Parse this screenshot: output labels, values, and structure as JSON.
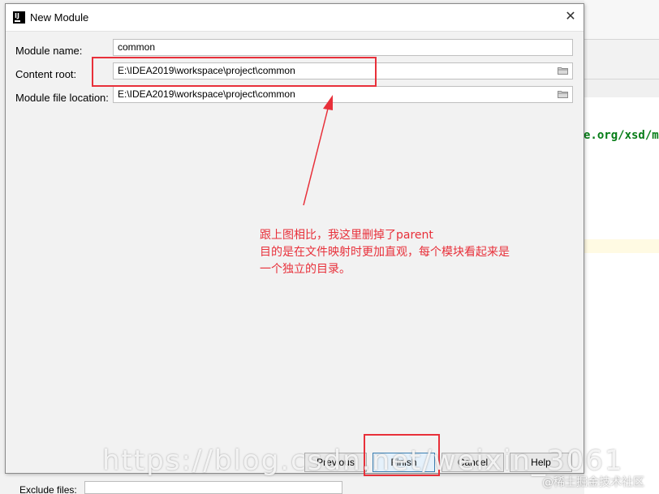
{
  "dialog": {
    "title": "New Module",
    "close_glyph": "✕"
  },
  "form": {
    "module_name": {
      "label": "Module name:",
      "value": "common"
    },
    "content_root": {
      "label": "Content root:",
      "value": "E:\\IDEA2019\\workspace\\project\\common"
    },
    "module_file_location": {
      "label": "Module file location:",
      "value": "E:\\IDEA2019\\workspace\\project\\common"
    }
  },
  "buttons": {
    "previous": "Previous",
    "finish": "Finish",
    "cancel": "Cancel",
    "help": "Help"
  },
  "background": {
    "code_fragment": "e.org/xsd/m",
    "exclude_label": "Exclude files:"
  },
  "annotation": {
    "lines": [
      "跟上图相比，我这里删掉了parent",
      "目的是在文件映射时更加直观，每个模块看起来是",
      "一个独立的目录。"
    ]
  },
  "watermark": {
    "url": "https://blog.csdn.net/weixin_3061",
    "site": "@稀土掘金技术社区"
  },
  "colors": {
    "annotation_red": "#e8303a",
    "code_green": "#067d17",
    "default_button_border": "#3c7fb1"
  },
  "icons": {
    "app": "intellij-idea-icon",
    "folder": "folder-icon",
    "close": "close-icon"
  }
}
